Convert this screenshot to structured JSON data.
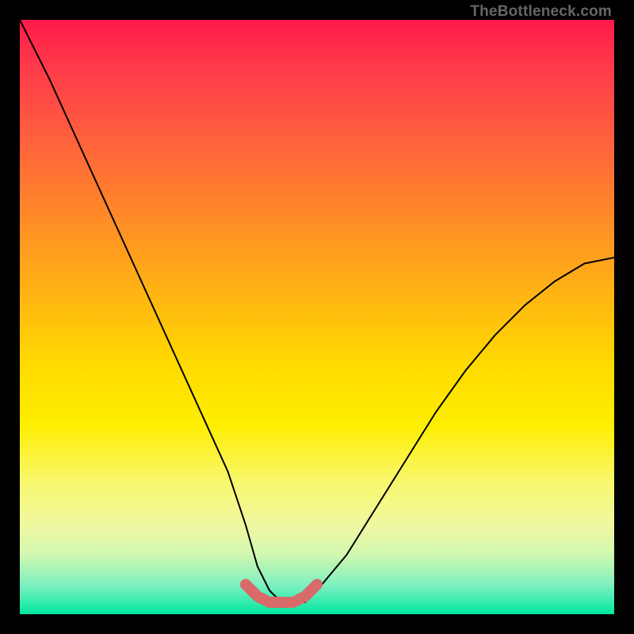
{
  "watermark": "TheBottleneck.com",
  "chart_data": {
    "type": "line",
    "title": "",
    "xlabel": "",
    "ylabel": "",
    "xlim": [
      0,
      100
    ],
    "ylim": [
      0,
      100
    ],
    "series": [
      {
        "name": "bottleneck-curve",
        "x": [
          0,
          5,
          10,
          15,
          20,
          25,
          30,
          35,
          38,
          40,
          42,
          44,
          46,
          48,
          50,
          55,
          60,
          65,
          70,
          75,
          80,
          85,
          90,
          95,
          100
        ],
        "y": [
          100,
          90,
          79,
          68,
          57,
          46,
          35,
          24,
          15,
          8,
          4,
          2,
          2,
          2,
          4,
          10,
          18,
          26,
          34,
          41,
          47,
          52,
          56,
          59,
          60
        ]
      },
      {
        "name": "highlight-band",
        "x": [
          38,
          40,
          42,
          44,
          46,
          48,
          50
        ],
        "y": [
          5,
          3,
          2,
          2,
          2,
          3,
          5
        ]
      }
    ],
    "colors": {
      "curve": "#000000",
      "highlight": "#d96a6a"
    }
  }
}
